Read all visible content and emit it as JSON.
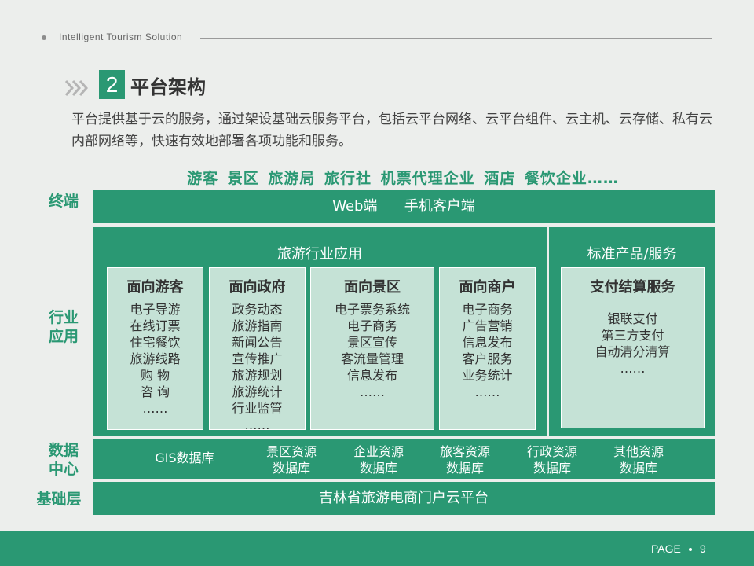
{
  "header": {
    "subtitle": "Intelligent  Tourism  Solution"
  },
  "section": {
    "number": "2",
    "title": "平台架构"
  },
  "intro": "平台提供基于云的服务，通过架设基础云服务平台，包括云平台网络、云平台组件、云主机、云存储、私有云内部网络等，快速有效地部署各项功能和服务。",
  "users_line": "游客 景区 旅游局 旅行社 机票代理企业 酒店 餐饮企业……",
  "layers": {
    "terminal": {
      "label": "终端",
      "content": "Web端      手机客户端"
    },
    "industry": {
      "label": "行业\n应用"
    },
    "data": {
      "label": "数据\n中心"
    },
    "base": {
      "label": "基础层",
      "content": "吉林省旅游电商门户云平台"
    }
  },
  "tourism_apps": {
    "title": "旅游行业应用",
    "cards": [
      {
        "title": "面向游客",
        "items": [
          "电子导游",
          "在线订票",
          "住宅餐饮",
          "旅游线路",
          "购 物",
          "咨 询",
          "……"
        ]
      },
      {
        "title": "面向政府",
        "items": [
          "政务动态",
          "旅游指南",
          "新闻公告",
          "宣传推广",
          "旅游规划",
          "旅游统计",
          "行业监管",
          "……"
        ]
      },
      {
        "title": "面向景区",
        "items": [
          "电子票务系统",
          "电子商务",
          "景区宣传",
          "客流量管理",
          "信息发布",
          "……"
        ]
      },
      {
        "title": "面向商户",
        "items": [
          "电子商务",
          "广告营销",
          "信息发布",
          "客户服务",
          "业务统计",
          "……"
        ]
      }
    ]
  },
  "standard_products": {
    "title": "标准产品/服务",
    "card": {
      "title": "支付结算服务",
      "items": [
        "银联支付",
        "第三方支付",
        "自动清分清算",
        "……"
      ]
    }
  },
  "databases": [
    {
      "line1": "GIS数据库",
      "line2": ""
    },
    {
      "line1": "景区资源",
      "line2": "数据库"
    },
    {
      "line1": "企业资源",
      "line2": "数据库"
    },
    {
      "line1": "旅客资源",
      "line2": "数据库"
    },
    {
      "line1": "行政资源",
      "line2": "数据库"
    },
    {
      "line1": "其他资源",
      "line2": "数据库"
    }
  ],
  "footer": {
    "page_label": "PAGE",
    "page_number": "9"
  },
  "colors": {
    "accent": "#2a9873",
    "card": "#c5e2d6",
    "background": "#eceeec"
  }
}
